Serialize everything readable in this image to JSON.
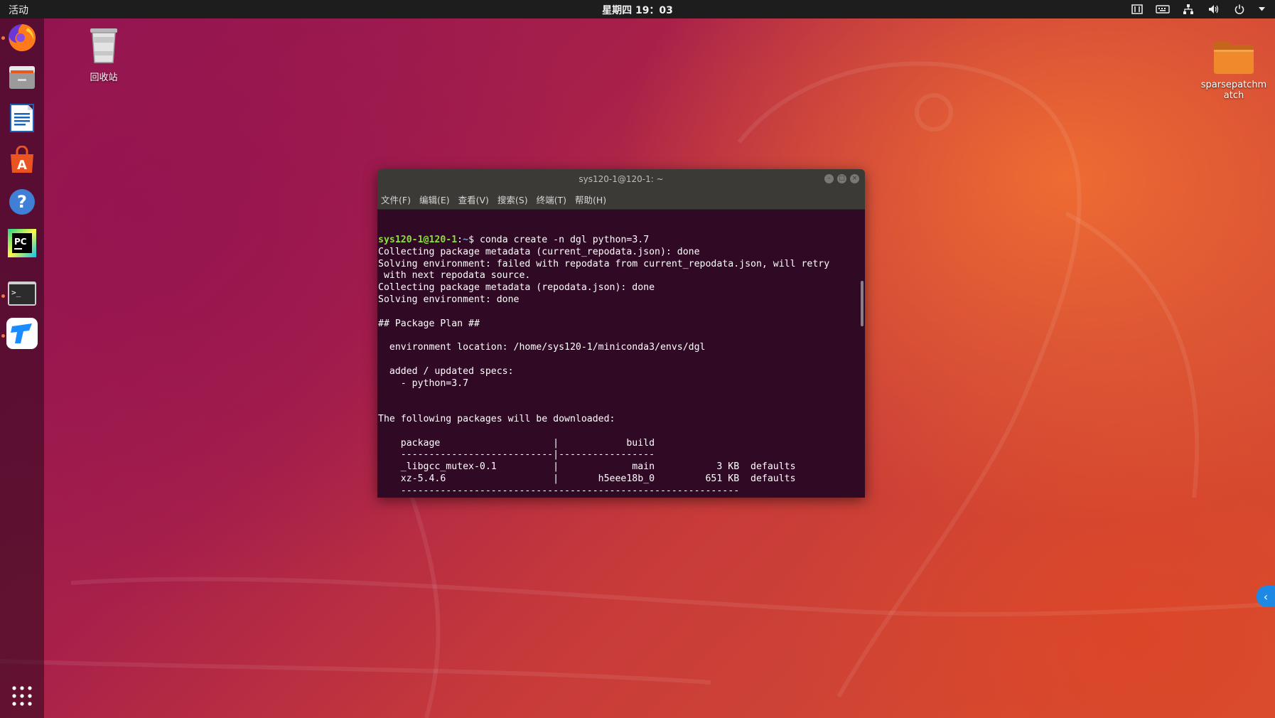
{
  "topbar": {
    "activities": "活动",
    "clock": "星期四 19：03"
  },
  "dock": {
    "items": [
      "firefox-icon",
      "files-icon",
      "writer-icon",
      "software-icon",
      "help-icon",
      "pycharm-icon",
      "terminal-icon",
      "todesk-icon"
    ],
    "apps_grid": "show-applications-icon"
  },
  "desktop": {
    "trash_label": "回收站",
    "folder_label_line1": "sparsepatchm",
    "folder_label_line2": "atch"
  },
  "terminal": {
    "title": "sys120-1@120-1: ~",
    "menu": [
      "文件(F)",
      "编辑(E)",
      "查看(V)",
      "搜索(S)",
      "终端(T)",
      "帮助(H)"
    ],
    "prompt_user": "sys120-1@120-1",
    "prompt_sep": ":",
    "prompt_path": "~",
    "prompt_dollar": "$ ",
    "command": "conda create -n dgl python=3.7",
    "lines": [
      "Collecting package metadata (current_repodata.json): done",
      "Solving environment: failed with repodata from current_repodata.json, will retry",
      " with next repodata source.",
      "Collecting package metadata (repodata.json): done",
      "Solving environment: done",
      "",
      "## Package Plan ##",
      "",
      "  environment location: /home/sys120-1/miniconda3/envs/dgl",
      "",
      "  added / updated specs:",
      "    - python=3.7",
      "",
      "",
      "The following packages will be downloaded:",
      "",
      "    package                    |            build",
      "    ---------------------------|-----------------",
      "    _libgcc_mutex-0.1          |             main           3 KB  defaults",
      "    xz-5.4.6                   |       h5eee18b_0         651 KB  defaults",
      "    ------------------------------------------------------------"
    ]
  }
}
